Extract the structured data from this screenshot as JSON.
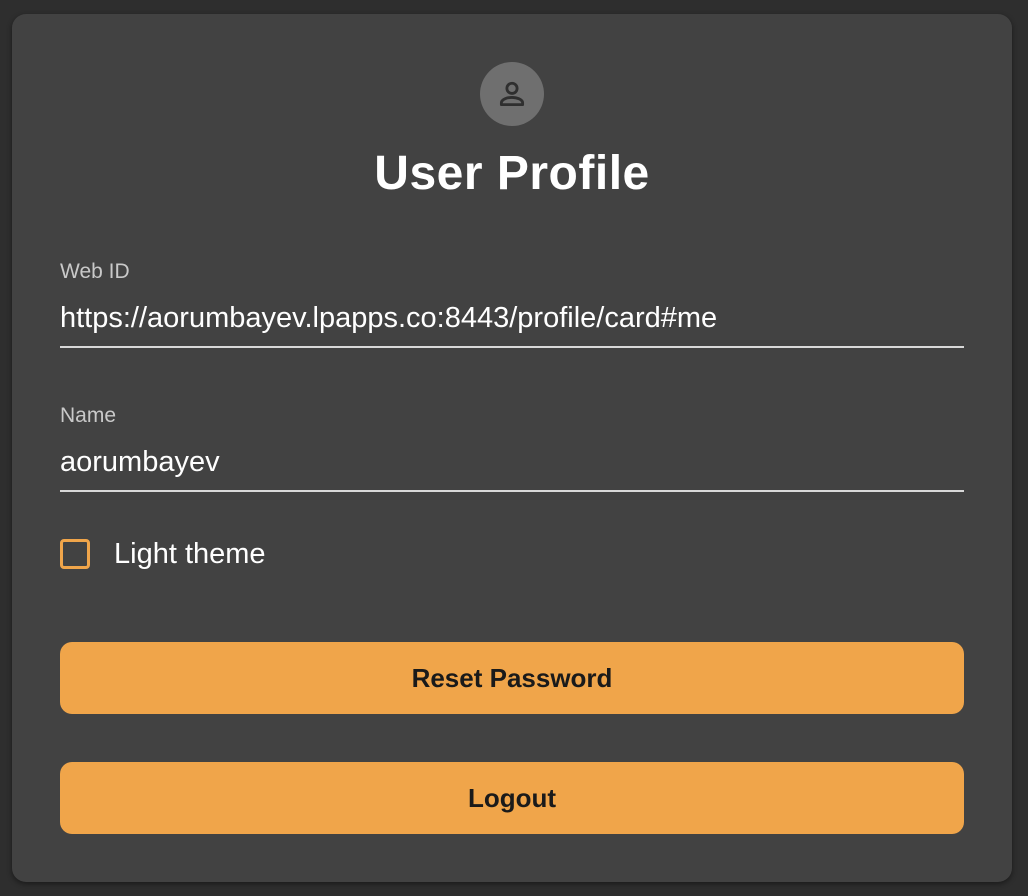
{
  "profile": {
    "avatar_icon": "person-icon",
    "title": "User Profile",
    "web_id": {
      "label": "Web ID",
      "value": "https://aorumbayev.lpapps.co:8443/profile/card#me"
    },
    "name": {
      "label": "Name",
      "value": "aorumbayev"
    },
    "light_theme": {
      "label": "Light theme",
      "checked": false
    },
    "reset_password_label": "Reset Password",
    "logout_label": "Logout"
  },
  "colors": {
    "page_background": "#2e2e2e",
    "card_background": "#424242",
    "accent": "#f0a54a",
    "avatar_background": "#6f6f6f"
  }
}
